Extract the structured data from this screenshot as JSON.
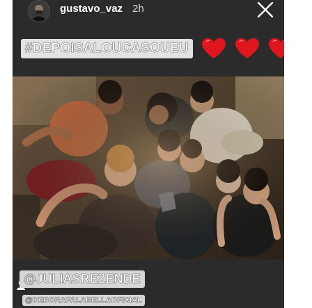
{
  "story": {
    "username": "gustavo_vaz",
    "time_ago": "2h",
    "hashtag": "#DEPOISALOUCASOUEU",
    "heart_count": 3,
    "mentions": [
      "@JULIASREZENDE",
      "@DEBORAFALABELLAOFICIAL"
    ]
  },
  "icons": {
    "avatar": "profile-avatar",
    "close": "close-icon",
    "heart": "heart-icon",
    "person": "person-tag-icon"
  },
  "colors": {
    "background": "#2b2b2b",
    "heart": "#e0161f",
    "sticker_bg": "#e2e2e2",
    "text": "#ffffff"
  }
}
